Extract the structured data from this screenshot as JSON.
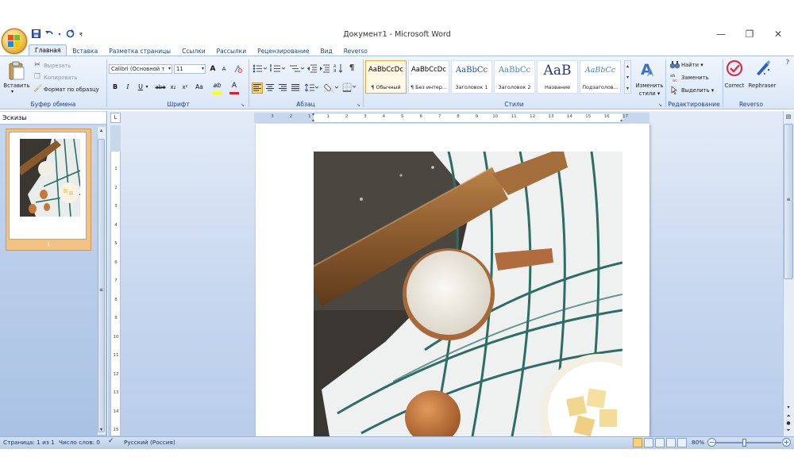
{
  "window": {
    "title": "Документ1 - Microsoft Word",
    "minimize": "—",
    "maximize": "❐",
    "close": "✕"
  },
  "quick_access": {
    "customize": "₹"
  },
  "tabs": [
    "Главная",
    "Вставка",
    "Разметка страницы",
    "Ссылки",
    "Рассылки",
    "Рецензирование",
    "Вид",
    "Reverso"
  ],
  "active_tab": "Главная",
  "ribbon": {
    "clipboard": {
      "label": "Буфер обмена",
      "paste": "Вставить",
      "cut": "Вырезать",
      "copy": "Копировать",
      "format_painter": "Формат по образцу"
    },
    "font": {
      "label": "Шрифт",
      "font_name": "Calibri (Основной т",
      "font_size": "11",
      "grow": "A",
      "shrink": "A",
      "bold": "B",
      "italic": "I",
      "underline": "U",
      "strike": "abe",
      "subscript": "x₂",
      "superscript": "x²",
      "change_case": "Aa",
      "highlight": "ab",
      "font_color": "A",
      "highlight_color": "#ffff00",
      "font_color_value": "#e02020"
    },
    "paragraph": {
      "label": "Абзац",
      "pilcrow": "¶"
    },
    "styles": {
      "label": "Стили",
      "items": [
        {
          "sample": "AaBbCcDc",
          "name": "¶ Обычный"
        },
        {
          "sample": "AaBbCcDc",
          "name": "¶ Без интер..."
        },
        {
          "sample": "AaBbCc",
          "name": "Заголовок 1"
        },
        {
          "sample": "AaBbCc",
          "name": "Заголовок 2"
        },
        {
          "sample": "AaB",
          "name": "Название"
        },
        {
          "sample": "AaBbCc",
          "name": "Подзаголов..."
        }
      ],
      "change_styles_line1": "Изменить",
      "change_styles_line2": "стили"
    },
    "editing": {
      "label": "Редактирование",
      "find": "Найти",
      "replace": "Заменить",
      "select": "Выделить"
    },
    "reverso": {
      "label": "Reverso",
      "correct": "Correct",
      "rephraser": "Rephraser"
    }
  },
  "left_pane": {
    "title": "Эскизы",
    "page_number": "1"
  },
  "ruler": {
    "toggle": "L",
    "h_numbers": [
      "3",
      "2",
      "1",
      "1",
      "2",
      "3",
      "4",
      "5",
      "6",
      "7",
      "8",
      "9",
      "10",
      "11",
      "12",
      "13",
      "14",
      "15",
      "16",
      "17"
    ],
    "v_numbers": [
      "1",
      "2",
      "3",
      "4",
      "5",
      "6",
      "7",
      "8",
      "9",
      "10",
      "11",
      "12",
      "13",
      "14",
      "15"
    ]
  },
  "status": {
    "page": "Страница: 1 из 1",
    "words": "Число слов: 0",
    "language": "Русский (Россия)",
    "zoom": "80%",
    "zoom_level": 0.8
  },
  "colors": {
    "ribbon_accent": "#15428b",
    "selected_style_border": "#e3a93a",
    "thumb_highlight": "#f3c283"
  }
}
